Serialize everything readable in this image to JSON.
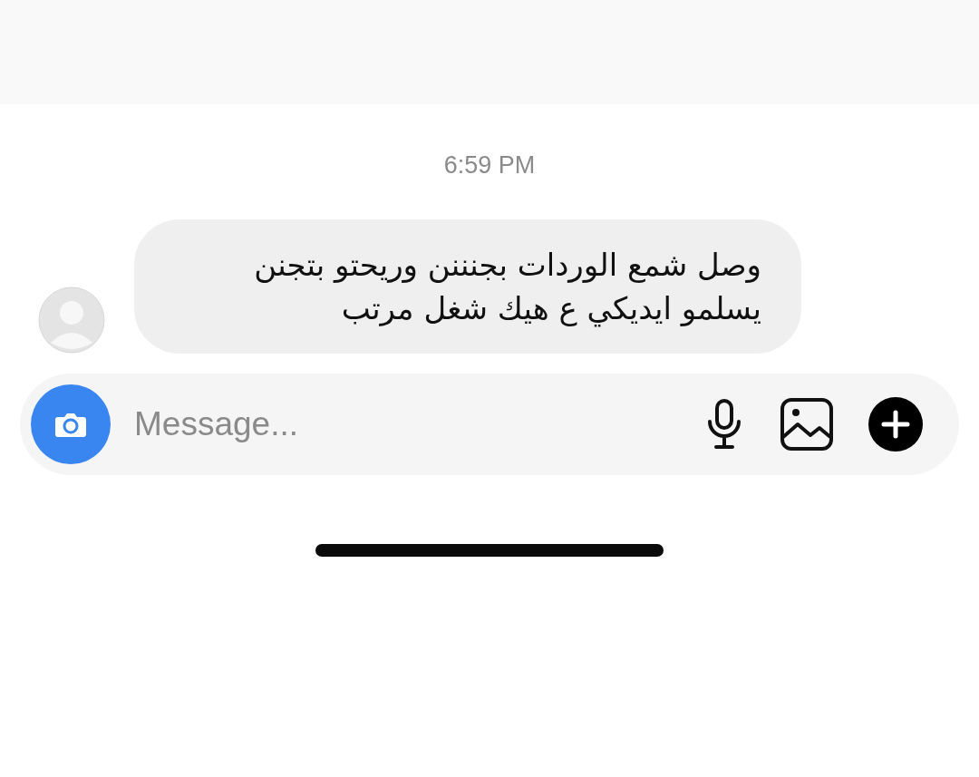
{
  "timestamp": "6:59 PM",
  "messages": [
    {
      "text": "وصل شمع الوردات بجنننن وريحتو بتجنن\nيسلمو ايديكي ع هيك شغل مرتب",
      "kind": "incoming"
    }
  ],
  "composer": {
    "placeholder": "Message..."
  }
}
